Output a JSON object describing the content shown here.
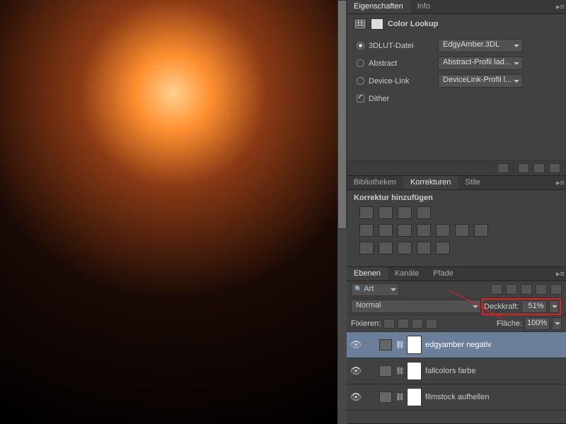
{
  "properties": {
    "tabs": [
      "Eigenschaften",
      "Info"
    ],
    "title": "Color Lookup",
    "rows": [
      {
        "label": "3DLUT-Datei",
        "value": "EdgyAmber.3DL",
        "selected": true
      },
      {
        "label": "Abstract",
        "value": "Abstract-Profil lad...",
        "selected": false
      },
      {
        "label": "Device-Link",
        "value": "DeviceLink-Profil l...",
        "selected": false
      }
    ],
    "dither": "Dither"
  },
  "corrections": {
    "tabs": [
      "Bibliotheken",
      "Korrekturen",
      "Stile"
    ],
    "heading": "Korrektur hinzufügen"
  },
  "layers": {
    "tabs": [
      "Ebenen",
      "Kanäle",
      "Pfade"
    ],
    "filter_label": "Art",
    "blend_mode": "Normal",
    "opacity_label": "Deckkraft:",
    "opacity_value": "51%",
    "lock_label": "Fixieren:",
    "fill_label": "Fläche:",
    "fill_value": "100%",
    "items": [
      {
        "name": "edgyamber negativ",
        "selected": true
      },
      {
        "name": "fallcolors farbe",
        "selected": false
      },
      {
        "name": "filmstock aufhellen",
        "selected": false
      }
    ]
  }
}
